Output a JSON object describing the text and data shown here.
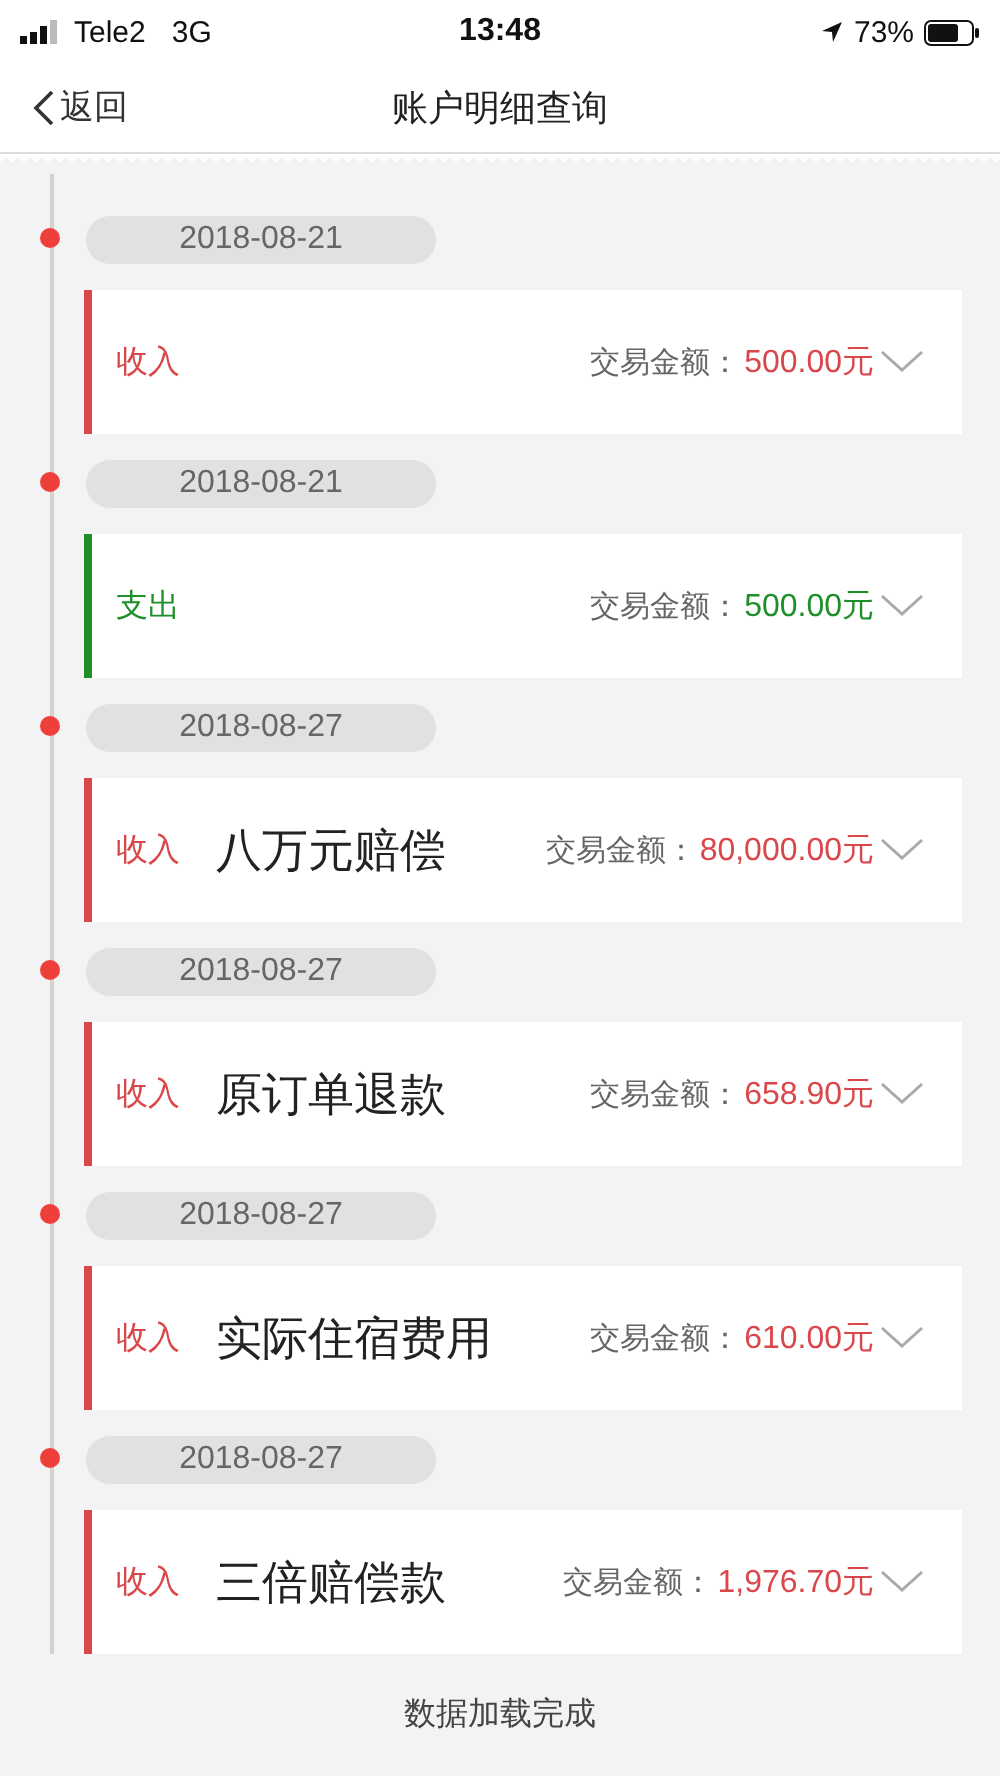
{
  "status_bar": {
    "carrier": "Tele2",
    "network": "3G",
    "time": "13:48",
    "battery": "73%"
  },
  "nav": {
    "back": "返回",
    "title": "账户明细查询"
  },
  "transactions": [
    {
      "date": "2018-08-21",
      "kind": "income",
      "type": "收入",
      "amount_label": "交易金额：",
      "amount": "500.00元",
      "expanded": false
    },
    {
      "date": "2018-08-21",
      "kind": "expense",
      "type": "支出",
      "amount_label": "交易金额：",
      "amount": "500.00元",
      "expanded": false
    },
    {
      "date": "2018-08-27",
      "kind": "income",
      "type": "收入",
      "note": "八万元赔偿",
      "amount_label": "交易金额：",
      "amount": "80,000.00元",
      "expanded": false
    },
    {
      "date": "2018-08-27",
      "kind": "income",
      "type": "收入",
      "note": "原订单退款",
      "amount_label": "交易金额：",
      "amount": "658.90元",
      "expanded": false
    },
    {
      "date": "2018-08-27",
      "kind": "income",
      "type": "收入",
      "note": "实际住宿费用",
      "amount_label": "交易金额：",
      "amount": "610.00元",
      "expanded": false
    },
    {
      "date": "2018-08-27",
      "kind": "income",
      "type": "收入",
      "note": "三倍赔偿款",
      "amount_label": "交易金额：",
      "amount": "1,976.70元",
      "expanded": false
    }
  ],
  "footer": "数据加载完成"
}
